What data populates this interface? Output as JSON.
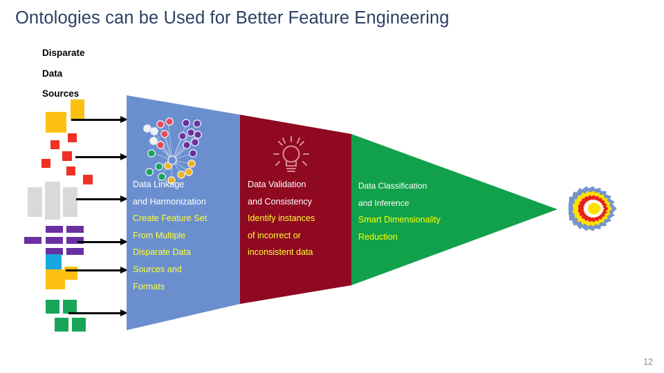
{
  "slide": {
    "title": "Ontologies can be Used for Better Feature Engineering",
    "page_number": "12"
  },
  "source_label": {
    "line1": "Disparate",
    "line2": "Data",
    "line3": "Sources"
  },
  "colors": {
    "title": "#2b3f63",
    "blue_section": "#6b8fce",
    "red_section": "#8f0921",
    "green_section": "#12a14b",
    "header_text": "#ffffff",
    "body_text": "#ffff33",
    "arrow": "#000000",
    "page_number": "#8c8c8c",
    "icon_yellow": "#fdc010",
    "icon_red": "#ef3124",
    "icon_gray": "#d9d9d9",
    "icon_purple": "#6a2fa0",
    "icon_cyan": "#18a7e0",
    "icon_green": "#18a558",
    "starburst_blue": "#7494cd",
    "starburst_yellow": "#ffe000",
    "starburst_red": "#e8201a",
    "starburst_white": "#ffffff",
    "starburst_core": "#ffe000"
  },
  "funnel": {
    "sections": [
      {
        "key": "blue",
        "icon": "network-graph-icon",
        "header_lines": [
          "Data Linkage",
          "and Harmonization"
        ],
        "body_lines": [
          "Create Feature Set",
          "From Multiple",
          "Disparate Data",
          "Sources and",
          "Formats"
        ]
      },
      {
        "key": "red",
        "icon": "lightbulb-icon",
        "header_lines": [
          "Data Validation",
          "and Consistency"
        ],
        "body_lines": [
          "Identify instances",
          "of incorrect or",
          "inconsistent data"
        ]
      },
      {
        "key": "green",
        "icon": "none",
        "header_lines": [
          "Data Classification",
          "and Inference"
        ],
        "body_lines": [
          "Smart Dimensionality",
          "Reduction"
        ]
      }
    ]
  },
  "source_icons": [
    {
      "name": "yellow-squares-icon",
      "color": "#fdc010"
    },
    {
      "name": "red-squares-icon",
      "color": "#ef3124"
    },
    {
      "name": "gray-bars-icon",
      "color": "#d9d9d9"
    },
    {
      "name": "purple-bars-icon",
      "color": "#6a2fa0"
    },
    {
      "name": "cyan-yellow-squares-icon",
      "color": "#18a7e0"
    },
    {
      "name": "green-squares-icon",
      "color": "#18a558"
    }
  ],
  "output_icon": {
    "name": "starburst-icon"
  }
}
